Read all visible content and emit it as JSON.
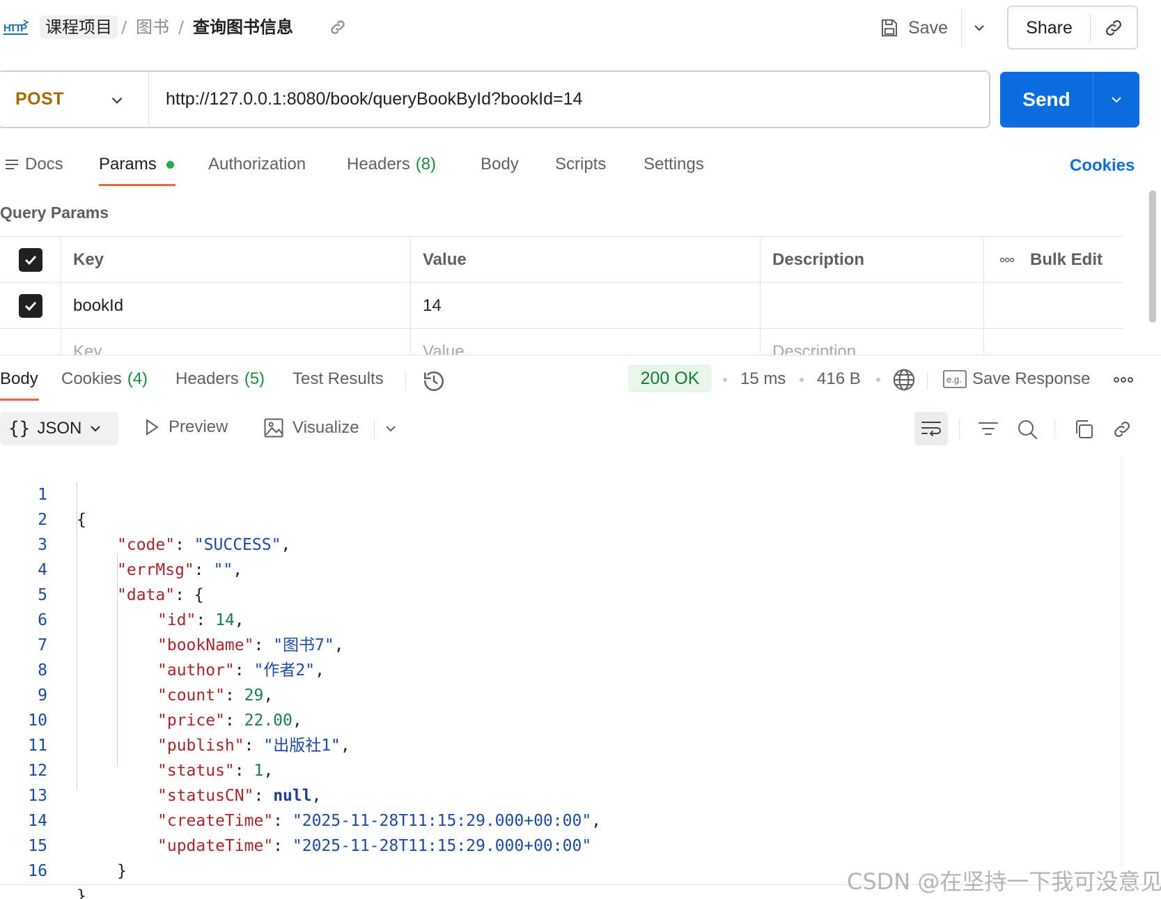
{
  "breadcrumb": {
    "badge": "HTTP",
    "collection": "课程项目",
    "separator": "/",
    "folder": "图书",
    "request": "查询图书信息"
  },
  "header_actions": {
    "save_label": "Save",
    "share_label": "Share"
  },
  "request": {
    "method": "POST",
    "url": "http://127.0.0.1:8080/book/queryBookById?bookId=14",
    "send_label": "Send"
  },
  "request_tabs": {
    "docs": "Docs",
    "params": "Params",
    "authorization": "Authorization",
    "headers": "Headers",
    "headers_count": "(8)",
    "body": "Body",
    "scripts": "Scripts",
    "settings": "Settings",
    "cookies": "Cookies"
  },
  "query_params": {
    "title": "Query Params",
    "headers": {
      "key": "Key",
      "value": "Value",
      "description": "Description",
      "bulk_edit": "Bulk Edit"
    },
    "rows": [
      {
        "checked": true,
        "key": "bookId",
        "value": "14",
        "description": ""
      }
    ],
    "placeholder": {
      "key": "Key",
      "value": "Value",
      "description": "Description"
    }
  },
  "response_tabs": {
    "body": "Body",
    "cookies": "Cookies",
    "cookies_count": "(4)",
    "headers": "Headers",
    "headers_count": "(5)",
    "test_results": "Test Results"
  },
  "response_meta": {
    "status": "200 OK",
    "time": "15 ms",
    "size": "416 B",
    "save_response": "Save Response"
  },
  "format_bar": {
    "format": "JSON",
    "preview": "Preview",
    "visualize": "Visualize"
  },
  "code_lines": [
    {
      "n": "1"
    },
    {
      "n": "2"
    },
    {
      "n": "3"
    },
    {
      "n": "4"
    },
    {
      "n": "5"
    },
    {
      "n": "6"
    },
    {
      "n": "7"
    },
    {
      "n": "8"
    },
    {
      "n": "9"
    },
    {
      "n": "10"
    },
    {
      "n": "11"
    },
    {
      "n": "12"
    },
    {
      "n": "13"
    },
    {
      "n": "14"
    },
    {
      "n": "15"
    },
    {
      "n": "16"
    }
  ],
  "response_body": {
    "code": "SUCCESS",
    "errMsg": "",
    "data": {
      "id": "14",
      "bookName": "图书7",
      "author": "作者2",
      "count": "29",
      "price": "22.00",
      "publish": "出版社1",
      "status": "1",
      "statusCN": "null",
      "createTime": "2025-11-28T11:15:29.000+00:00",
      "updateTime": "2025-11-28T11:15:29.000+00:00"
    }
  },
  "watermark": "CSDN @在坚持一下我可没意见",
  "colors": {
    "accent_blue": "#0d6cde",
    "method_post": "#a66a00",
    "status_green": "#167d36",
    "json_key": "#a6262c",
    "json_string": "#1d4aa5",
    "json_number": "#1b7d4c",
    "tab_underline": "#e8673b"
  }
}
